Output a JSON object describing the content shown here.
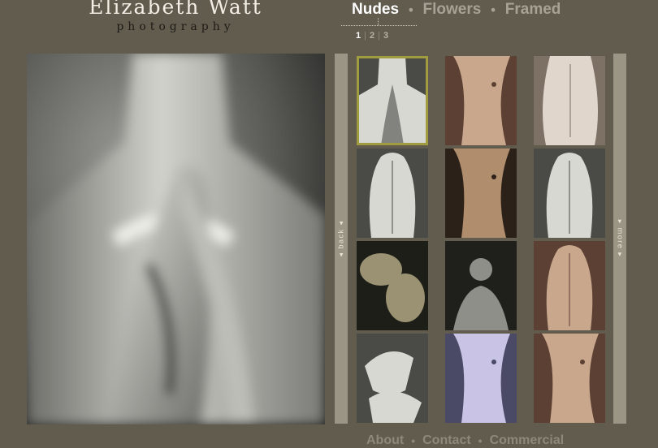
{
  "brand": {
    "name": "Elizabeth Watt",
    "tagline": "photography"
  },
  "categories": [
    {
      "label": "Nudes",
      "active": true
    },
    {
      "label": "Flowers",
      "active": false
    },
    {
      "label": "Framed",
      "active": false
    }
  ],
  "separator": "•",
  "pages": {
    "items": [
      "1",
      "2",
      "3"
    ],
    "current": "1",
    "divider": "|"
  },
  "sidebar": {
    "back": "◂ back ◂",
    "more": "▸ more ▸"
  },
  "footer": {
    "links": [
      "About",
      "Contact",
      "Commercial"
    ]
  },
  "colors": {
    "background": "#625c4f",
    "active_nav": "#ffffff",
    "inactive_nav": "#a7a294",
    "selection": "#a19c3f",
    "side_bar": "#9b9585"
  },
  "thumbnails": [
    {
      "tone": "grey",
      "selected": true,
      "icon": "praying-hands-icon"
    },
    {
      "tone": "sepia",
      "selected": false,
      "icon": "torso-icon"
    },
    {
      "tone": "beige",
      "selected": false,
      "icon": "torso-back-icon"
    },
    {
      "tone": "grey",
      "selected": false,
      "icon": "back-icon"
    },
    {
      "tone": "sepia-dark",
      "selected": false,
      "icon": "torso-icon"
    },
    {
      "tone": "grey",
      "selected": false,
      "icon": "back-icon"
    },
    {
      "tone": "green-dark",
      "selected": false,
      "icon": "feet-icon"
    },
    {
      "tone": "grey-dark",
      "selected": false,
      "icon": "figure-icon"
    },
    {
      "tone": "sepia",
      "selected": false,
      "icon": "back-icon"
    },
    {
      "tone": "grey",
      "selected": false,
      "icon": "hands-icon"
    },
    {
      "tone": "lavender",
      "selected": false,
      "icon": "torso-icon"
    },
    {
      "tone": "sepia",
      "selected": false,
      "icon": "torso-icon"
    }
  ]
}
